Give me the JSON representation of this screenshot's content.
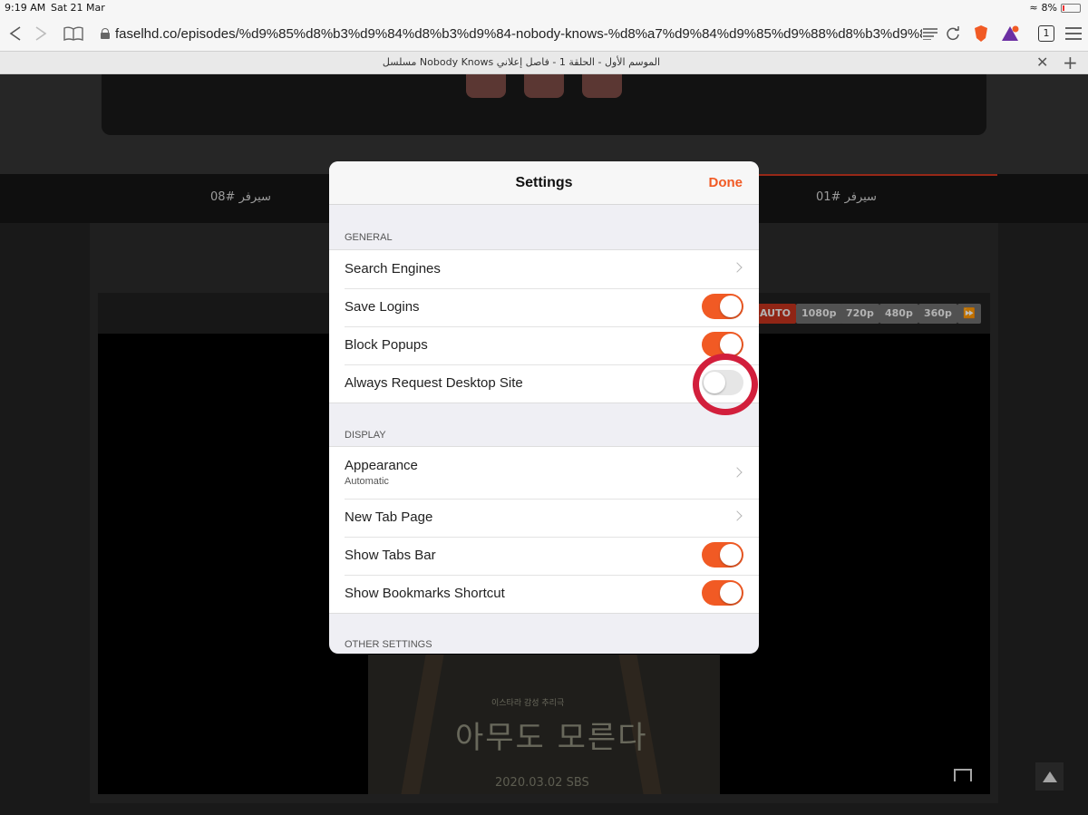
{
  "status_bar": {
    "time": "9:19 AM",
    "date": "Sat 21 Mar",
    "battery": "8%"
  },
  "browser": {
    "url": "faselhd.co/episodes/%d9%85%d8%b3%d9%84%d8%b3%d9%84-nobody-knows-%d8%a7%d9%84%d9%85%d9%88%d8%b3%d9%8...",
    "tab_count": "1",
    "tab_title": "مسلسل Nobody Knows الموسم الأول - الحلقة 1 - فاصل إعلاني"
  },
  "page": {
    "servers": [
      "سيرفر #08",
      "سيرفر #01"
    ],
    "qualities": [
      "AUTO",
      "1080p",
      "720p",
      "480p",
      "360p"
    ],
    "poster_subtitle": "이스타라 감성 추리극",
    "poster_title": "아무도 모른다",
    "poster_date": "2020.03.02  SBS"
  },
  "settings": {
    "title": "Settings",
    "done_label": "Done",
    "general_header": "GENERAL",
    "general": [
      {
        "label": "Search Engines",
        "type": "chevron"
      },
      {
        "label": "Save Logins",
        "type": "toggle",
        "on": true
      },
      {
        "label": "Block Popups",
        "type": "toggle",
        "on": true
      },
      {
        "label": "Always Request Desktop Site",
        "type": "toggle",
        "on": false
      }
    ],
    "display_header": "DISPLAY",
    "display": [
      {
        "label": "Appearance",
        "sublabel": "Automatic",
        "type": "chevron"
      },
      {
        "label": "New Tab Page",
        "type": "chevron"
      },
      {
        "label": "Show Tabs Bar",
        "type": "toggle",
        "on": true
      },
      {
        "label": "Show Bookmarks Shortcut",
        "type": "toggle",
        "on": true
      }
    ],
    "other_header": "OTHER SETTINGS"
  },
  "colors": {
    "accent": "#f15a24",
    "highlight": "#d21f3c"
  }
}
